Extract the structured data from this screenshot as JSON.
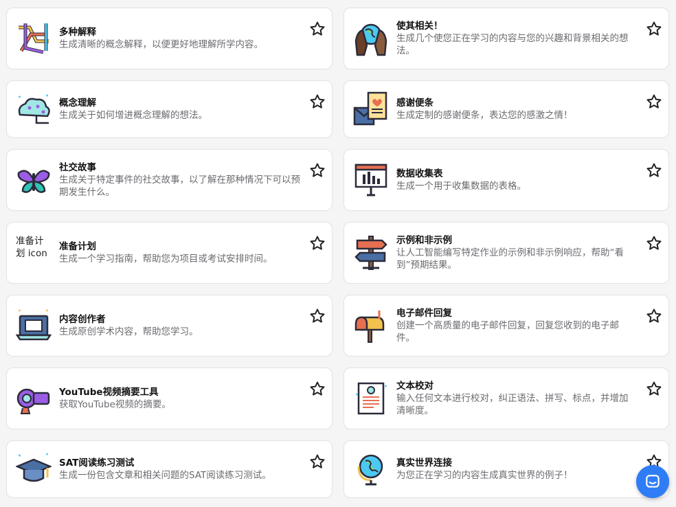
{
  "cards": [
    {
      "title": "多种解释",
      "desc": "生成清晰的概念解释，以便更好地理解所学内容。",
      "icon": "tangled-lines-icon"
    },
    {
      "title": "使其相关！",
      "desc": "生成几个使您正在学习的内容与您的兴趣和背景相关的想法。",
      "icon": "hands-globe-icon"
    },
    {
      "title": "概念理解",
      "desc": "生成关于如何增进概念理解的想法。",
      "icon": "brain-icon"
    },
    {
      "title": "感谢便条",
      "desc": "生成定制的感谢便条，表达您的感激之情！",
      "icon": "thank-you-note-icon"
    },
    {
      "title": "社交故事",
      "desc": "生成关于特定事件的社交故事，以了解在那种情况下可以预期发生什么。",
      "icon": "butterfly-icon"
    },
    {
      "title": "数据收集表",
      "desc": "生成一个用于收集数据的表格。",
      "icon": "presentation-board-icon"
    },
    {
      "title": "准备计划",
      "desc": "生成一个学习指南，帮助您为项目或考试安排时间。",
      "icon": "broken-image-icon",
      "img_alt": "准备计划 icon"
    },
    {
      "title": "示例和非示例",
      "desc": "让人工智能编写特定作业的示例和非示例响应，帮助“看到”预期结果。",
      "icon": "signpost-icon"
    },
    {
      "title": "内容创作者",
      "desc": "生成原创学术内容，帮助您学习。",
      "icon": "laptop-icon"
    },
    {
      "title": "电子邮件回复",
      "desc": "创建一个高质量的电子邮件回复，回复您收到的电子邮件。",
      "icon": "mailbox-icon"
    },
    {
      "title": "YouTube视频摘要工具",
      "desc": "获取YouTube视频的摘要。",
      "icon": "video-camera-icon"
    },
    {
      "title": "文本校对",
      "desc": "输入任何文本进行校对，纠正语法、拼写、标点，并增加清晰度。",
      "icon": "document-icon"
    },
    {
      "title": "SAT阅读练习测试",
      "desc": "生成一份包含文章和相关问题的SAT阅读练习测试。",
      "icon": "graduation-cap-icon"
    },
    {
      "title": "真实世界连接",
      "desc": "为您正在学习的内容生成真实世界的例子！",
      "icon": "desk-globe-icon"
    }
  ],
  "chat_button": {
    "icon": "chat-bubble-icon"
  }
}
